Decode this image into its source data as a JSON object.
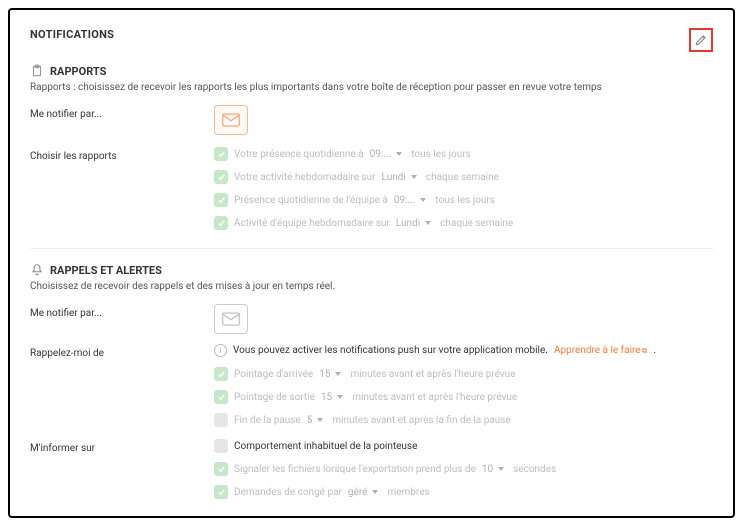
{
  "title": "NOTIFICATIONS",
  "edit": {
    "name": "edit"
  },
  "rapports": {
    "title": "RAPPORTS",
    "desc": "Rapports : choisissez de recevoir les rapports les plus importants dans votre boîte de réception pour passer en revue votre temps",
    "notify_label": "Me notifier par...",
    "choose_label": "Choisir les rapports",
    "items": [
      {
        "pre": "Votre présence quotidienne à",
        "val": "09:...",
        "post": "tous les jours"
      },
      {
        "pre": "Votre activité hebdomadaire sur",
        "val": "Lundi",
        "post": "chaque semaine"
      },
      {
        "pre": "Présence quotidienne de l'équipe à",
        "val": "09:...",
        "post": "tous les jours"
      },
      {
        "pre": "Activité d'équipe hebdomadaire sur",
        "val": "Lundi",
        "post": "chaque semaine"
      }
    ]
  },
  "rappels": {
    "title": "RAPPELS ET ALERTES",
    "desc": "Choisissez de recevoir des rappels et des mises à jour en temps réel.",
    "notify_label": "Me notifier par...",
    "push_text": "Vous pouvez activer les notifications push sur votre application mobile.",
    "push_link": "Apprendre à le faire",
    "remind_label": "Rappelez-moi de",
    "remind_items": [
      {
        "pre": "Pointage d'arrivée",
        "val": "15",
        "post": "minutes avant et après l'heure prévue",
        "state": "green"
      },
      {
        "pre": "Pointage de sortie",
        "val": "15",
        "post": "minutes avant et après l'heure prévue",
        "state": "green"
      },
      {
        "pre": "Fin de la pause",
        "val": "5",
        "post": "minutes avant et après la fin de la pause",
        "state": "grey"
      }
    ],
    "inform_label": "M'informer sur",
    "inform_items": [
      {
        "text": "Comportement inhabituel de la pointeuse",
        "state": "grey",
        "dark": true
      },
      {
        "pre": "Signaler les fichiers lorsque l'exportation prend plus de",
        "val": "10",
        "post": "secondes",
        "state": "green"
      },
      {
        "pre": "Demandes de congé par",
        "val": "géré",
        "post": "membres",
        "state": "green"
      }
    ]
  }
}
